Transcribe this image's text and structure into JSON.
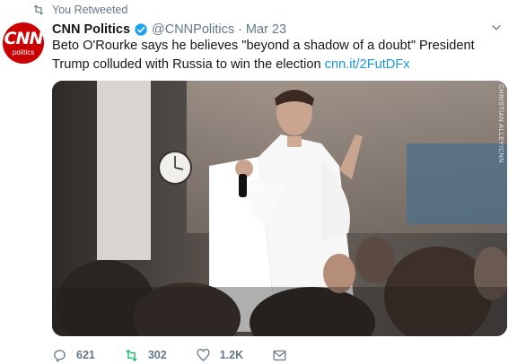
{
  "retweet_label": "You Retweeted",
  "author": {
    "name": "CNN Politics",
    "handle": "@CNNPolitics",
    "date": "Mar 23",
    "avatar_text": "CNN",
    "avatar_subtext": "politics"
  },
  "tweet": {
    "text": "Beto O'Rourke says he believes \"beyond a shadow of a doubt\" President Trump colluded with Russia to win the election",
    "link": "cnn.it/2FutDFx"
  },
  "media": {
    "credit": "CHRISTIAN ALLEY/CNN"
  },
  "actions": {
    "replies": "621",
    "retweets": "302",
    "likes": "1.2K"
  },
  "colors": {
    "link": "#1b95e0",
    "muted": "#657786",
    "retweeted": "#17bf63",
    "brand": "#cc0000"
  },
  "icons": {
    "retweet": "retweet-icon",
    "verified": "verified-badge-icon",
    "caret": "chevron-down-icon",
    "reply": "reply-icon",
    "like": "heart-icon",
    "dm": "envelope-icon"
  }
}
